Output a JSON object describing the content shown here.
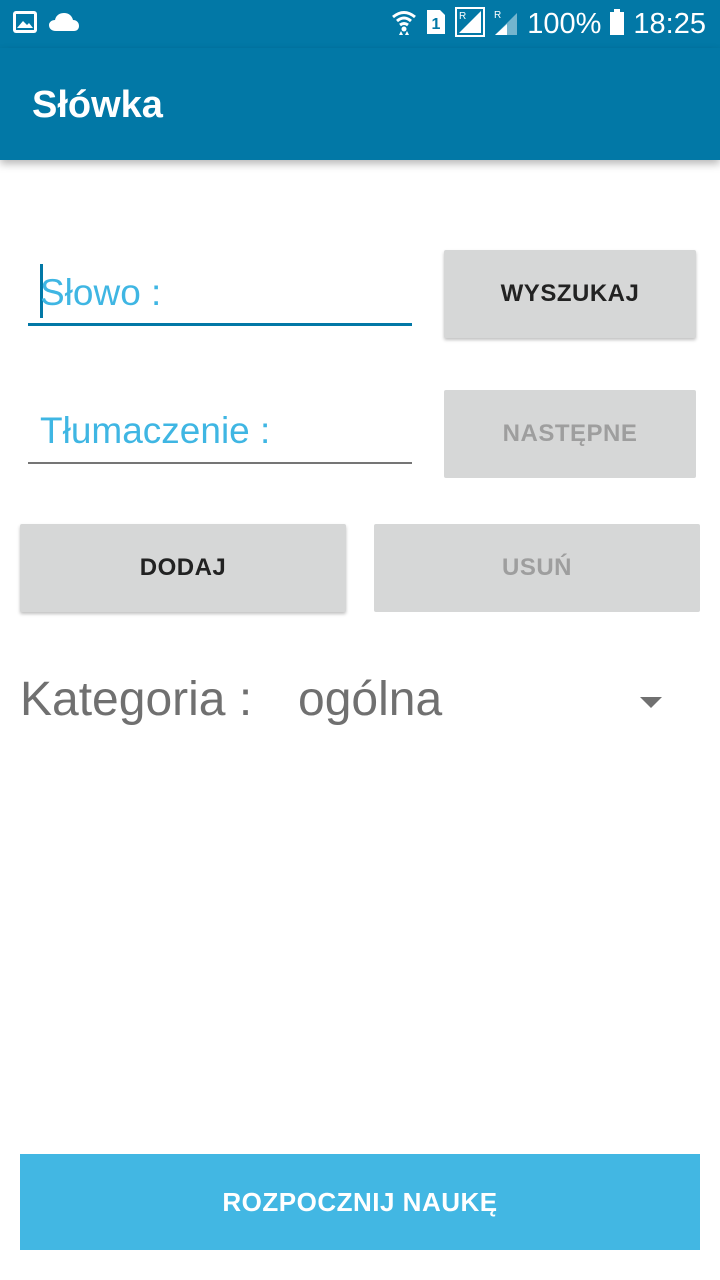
{
  "status_bar": {
    "icons_left": [
      "gallery-icon",
      "cloud-icon"
    ],
    "icons_right": [
      "wifi-icon",
      "sim1-icon",
      "signal-roaming-icon",
      "signal-roaming-icon",
      "battery-icon"
    ],
    "battery": "100%",
    "time": "18:25"
  },
  "app_bar": {
    "title": "Słówka"
  },
  "form": {
    "word_hint": "Słowo :",
    "translation_hint": "Tłumaczenie :",
    "search_label": "WYSZUKAJ",
    "next_label": "NASTĘPNE",
    "add_label": "DODAJ",
    "remove_label": "USUŃ"
  },
  "category": {
    "label": "Kategoria :",
    "selected": "ogólna"
  },
  "start_label": "ROZPOCZNIJ NAUKĘ",
  "colors": {
    "primary": "#0278a6",
    "accent": "#42b7e3",
    "hint": "#3fb6e3",
    "button_bg": "#d6d7d7"
  }
}
